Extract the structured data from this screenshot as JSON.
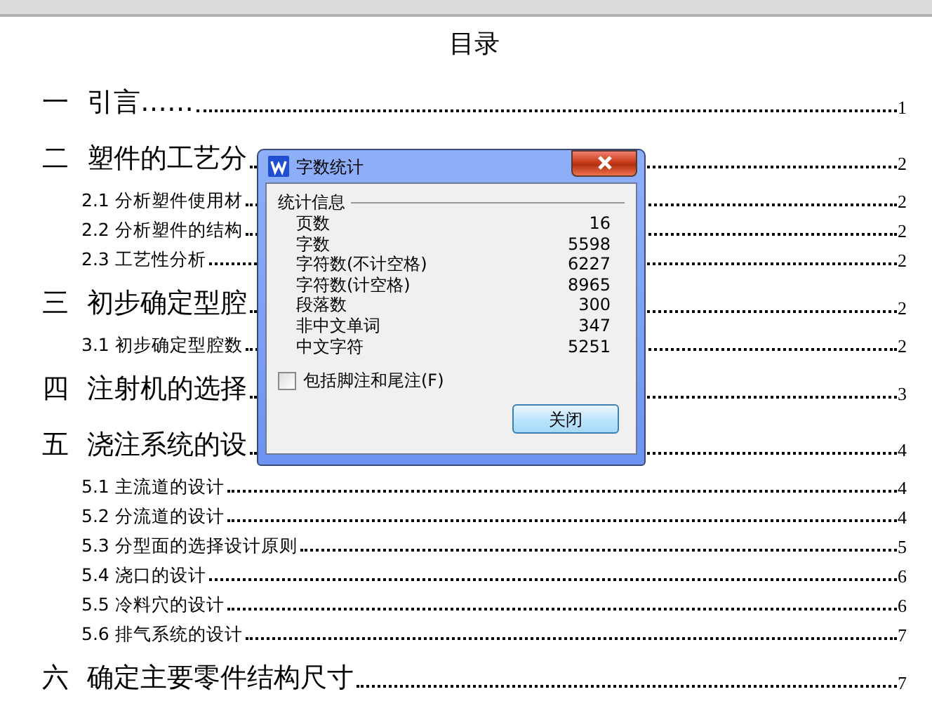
{
  "document": {
    "title": "目录",
    "sections": [
      {
        "number": "一",
        "title": "引言……",
        "page": "1"
      },
      {
        "number": "二",
        "title": "塑件的工艺分",
        "page": "2",
        "children": [
          {
            "title": "2.1 分析塑件使用材",
            "page": "2"
          },
          {
            "title": "2.2 分析塑件的结构",
            "page": "2"
          },
          {
            "title": "2.3 工艺性分析",
            "page": "2"
          }
        ]
      },
      {
        "number": "三",
        "title": "初步确定型腔",
        "page": "2",
        "children": [
          {
            "title": "3.1 初步确定型腔数",
            "page": "2"
          }
        ]
      },
      {
        "number": "四",
        "title": "注射机的选择",
        "page": "3"
      },
      {
        "number": "五",
        "title": "浇注系统的设",
        "page": "4",
        "children": [
          {
            "title": "5.1 主流道的设计",
            "page": "4"
          },
          {
            "title": "5.2 分流道的设计",
            "page": "4"
          },
          {
            "title": "5.3 分型面的选择设计原则",
            "page": "5"
          },
          {
            "title": "5.4 浇口的设计",
            "page": "6"
          },
          {
            "title": "5.5 冷料穴的设计",
            "page": "6"
          },
          {
            "title": "5.6 排气系统的设计",
            "page": "7"
          }
        ]
      },
      {
        "number": "六",
        "title": "确定主要零件结构尺寸",
        "page": "7"
      }
    ]
  },
  "dialog": {
    "title": "字数统计",
    "group_title": "统计信息",
    "stats": [
      {
        "label": "页数",
        "value": "16"
      },
      {
        "label": "字数",
        "value": "5598"
      },
      {
        "label": "字符数(不计空格)",
        "value": "6227"
      },
      {
        "label": "字符数(计空格)",
        "value": "8965"
      },
      {
        "label": "段落数",
        "value": "300"
      },
      {
        "label": "非中文单词",
        "value": "347"
      },
      {
        "label": "中文字符",
        "value": "5251"
      }
    ],
    "checkbox": {
      "label": "包括脚注和尾注(F)",
      "checked": false
    },
    "button": "关闭"
  }
}
